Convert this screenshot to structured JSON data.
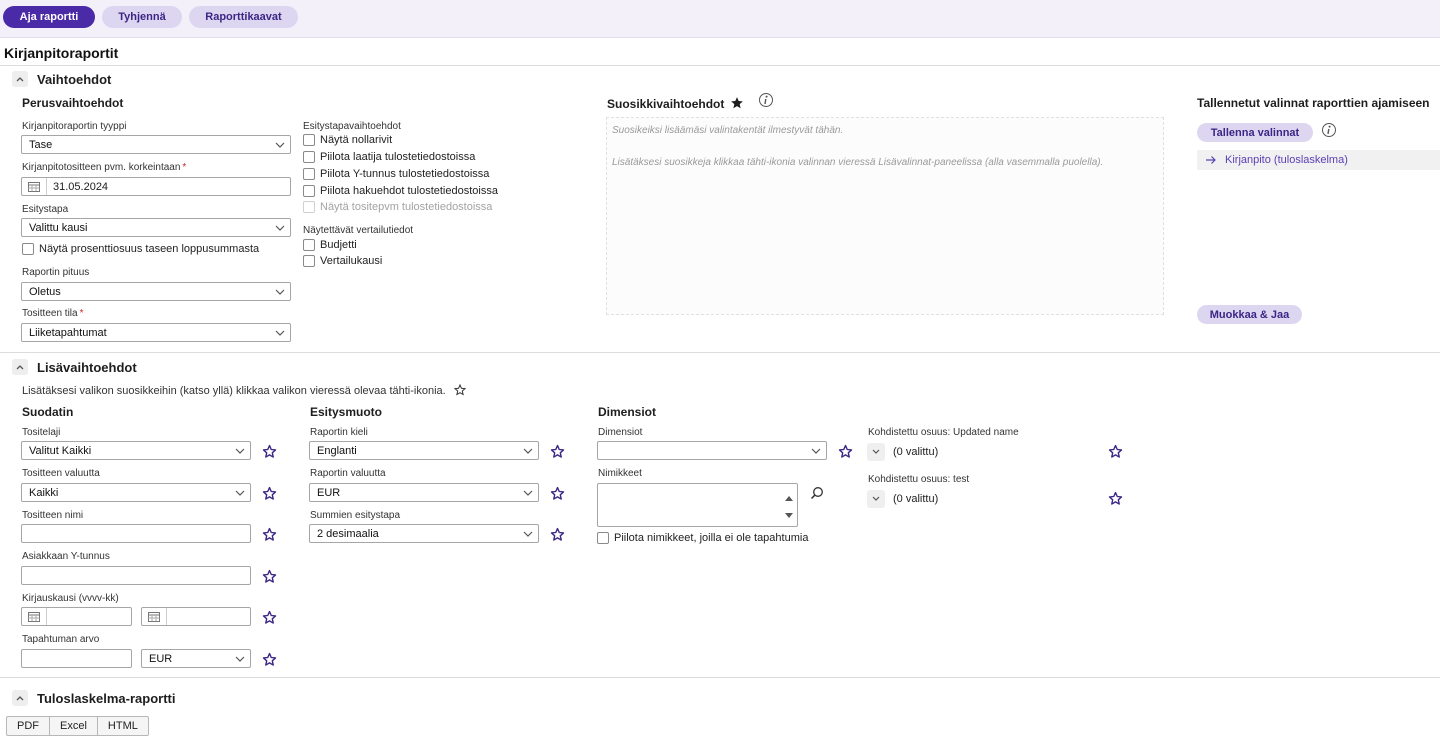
{
  "toolbar": {
    "run": "Aja raportti",
    "clear": "Tyhjennä",
    "templates": "Raporttikaavat"
  },
  "page": {
    "title": "Kirjanpitoraportit"
  },
  "options": {
    "title": "Vaihtoehdot",
    "basic": {
      "title": "Perusvaihtoehdot",
      "report_type_label": "Kirjanpitoraportin tyyppi",
      "report_type_value": "Tase",
      "date_label": "Kirjanpitotositteen pvm. korkeintaan",
      "date_value": "31.05.2024",
      "display_label": "Esitystapa",
      "display_value": "Valittu kausi",
      "show_percent": "Näytä prosenttiosuus taseen loppusummasta",
      "length_label": "Raportin pituus",
      "length_value": "Oletus",
      "status_label": "Tositteen tila",
      "status_value": "Liiketapahtumat"
    },
    "display": {
      "title": "Esitystapavaihtoehdot",
      "items": [
        "Näytä nollarivit",
        "Piilota laatija tulostetiedostoissa",
        "Piilota Y-tunnus tulostetiedostoissa",
        "Piilota hakuehdot tulostetiedostoissa",
        "Näytä tositepvm tulostetiedostoissa"
      ],
      "compare_title": "Näytettävät vertailutiedot",
      "compare_items": [
        "Budjetti",
        "Vertailukausi"
      ]
    },
    "favorites": {
      "title": "Suosikkivaihtoehdot",
      "text1": "Suosikeiksi lisäämäsi valintakentät ilmestyvät tähän.",
      "text2": "Lisätäksesi suosikkeja klikkaa tähti-ikonia valinnan vieressä Lisävalinnat-paneelissa (alla vasemmalla puolella)."
    },
    "saved": {
      "title": "Tallennetut valinnat raporttien ajamiseen",
      "save_button": "Tallenna valinnat",
      "item": "Kirjanpito (tuloslaskelma)",
      "edit_button": "Muokkaa & Jaa"
    }
  },
  "extra": {
    "title": "Lisävaihtoehdot",
    "hint": "Lisätäksesi valikon suosikkeihin (katso yllä) klikkaa valikon vieressä olevaa tähti-ikonia.",
    "filter": {
      "title": "Suodatin",
      "doc_type_label": "Tositelaji",
      "doc_type_value": "Valitut Kaikki",
      "currency_label": "Tositteen valuutta",
      "currency_value": "Kaikki",
      "name_label": "Tositteen nimi",
      "customer_label": "Asiakkaan Y-tunnus",
      "period_label": "Kirjauskausi (vvvv-kk)",
      "value_label": "Tapahtuman arvo",
      "value_currency": "EUR"
    },
    "format": {
      "title": "Esitysmuoto",
      "lang_label": "Raportin kieli",
      "lang_value": "Englanti",
      "currency_label": "Raportin valuutta",
      "currency_value": "EUR",
      "sum_label": "Summien esitystapa",
      "sum_value": "2 desimaalia"
    },
    "dimensions": {
      "title": "Dimensiot",
      "dim_label": "Dimensiot",
      "items_label": "Nimikkeet",
      "hide_items": "Piilota nimikkeet, joilla ei ole tapahtumia",
      "share1_label": "Kohdistettu osuus: Updated name",
      "share1_value": "(0 valittu)",
      "share2_label": "Kohdistettu osuus: test",
      "share2_value": "(0 valittu)"
    }
  },
  "report": {
    "title": "Tuloslaskelma-raportti",
    "exports": [
      "PDF",
      "Excel",
      "HTML"
    ]
  },
  "colors": {
    "accent": "#4b2aa8",
    "accent_soft": "#ddd6f1",
    "star": "#3b2585",
    "required": "#c62828"
  }
}
